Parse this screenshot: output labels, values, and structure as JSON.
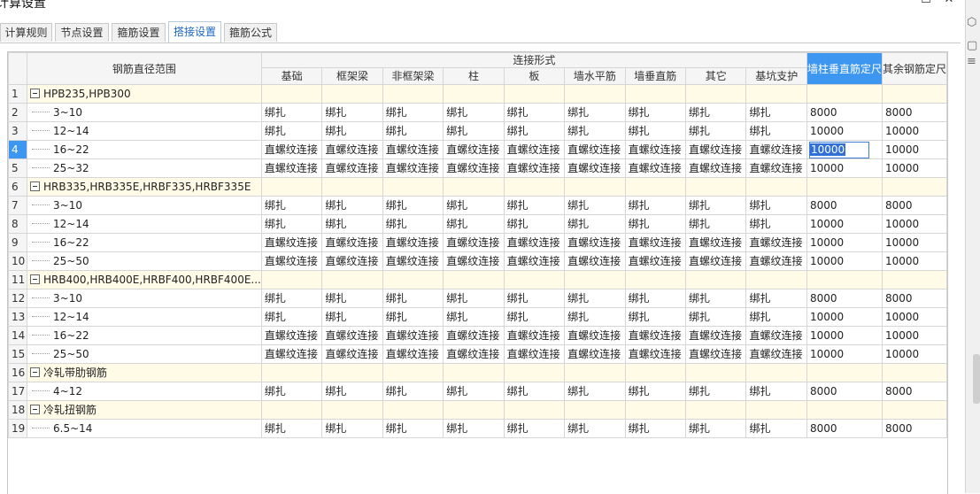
{
  "window": {
    "title": "计算设置",
    "minimize": "—",
    "maximize": "☐",
    "close": "✕"
  },
  "tabs": [
    {
      "label": "计算规则",
      "active": false
    },
    {
      "label": "节点设置",
      "active": false
    },
    {
      "label": "箍筋设置",
      "active": false
    },
    {
      "label": "搭接设置",
      "active": true
    },
    {
      "label": "箍筋公式",
      "active": false
    }
  ],
  "header": {
    "range_col": "钢筋直径范围",
    "group_col": "连接形式",
    "columns": [
      "基础",
      "框架梁",
      "非框架梁",
      "柱",
      "板",
      "墙水平筋",
      "墙垂直筋",
      "其它",
      "基坑支护"
    ],
    "col_wall_col_length": "墙柱垂直筋定尺",
    "col_other_length": "其余钢筋定尺"
  },
  "rows": [
    {
      "num": "1",
      "type": "group",
      "label": "HPB235,HPB300"
    },
    {
      "num": "2",
      "type": "item",
      "label": "3~10",
      "values": [
        "绑扎",
        "绑扎",
        "绑扎",
        "绑扎",
        "绑扎",
        "绑扎",
        "绑扎",
        "绑扎",
        "绑扎"
      ],
      "len1": "8000",
      "len2": "8000"
    },
    {
      "num": "3",
      "type": "item",
      "label": "12~14",
      "values": [
        "绑扎",
        "绑扎",
        "绑扎",
        "绑扎",
        "绑扎",
        "绑扎",
        "绑扎",
        "绑扎",
        "绑扎"
      ],
      "len1": "10000",
      "len2": "10000"
    },
    {
      "num": "4",
      "type": "item",
      "label": "16~22",
      "values": [
        "直螺纹连接",
        "直螺纹连接",
        "直螺纹连接",
        "直螺纹连接",
        "直螺纹连接",
        "直螺纹连接",
        "直螺纹连接",
        "直螺纹连接",
        "直螺纹连接"
      ],
      "len1": "10000",
      "len2": "10000",
      "selected": true
    },
    {
      "num": "5",
      "type": "item",
      "label": "25~32",
      "values": [
        "直螺纹连接",
        "直螺纹连接",
        "直螺纹连接",
        "直螺纹连接",
        "直螺纹连接",
        "直螺纹连接",
        "直螺纹连接",
        "直螺纹连接",
        "直螺纹连接"
      ],
      "len1": "10000",
      "len2": "10000"
    },
    {
      "num": "6",
      "type": "group",
      "label": "HRB335,HRB335E,HRBF335,HRBF335E"
    },
    {
      "num": "7",
      "type": "item",
      "label": "3~10",
      "values": [
        "绑扎",
        "绑扎",
        "绑扎",
        "绑扎",
        "绑扎",
        "绑扎",
        "绑扎",
        "绑扎",
        "绑扎"
      ],
      "len1": "8000",
      "len2": "8000"
    },
    {
      "num": "8",
      "type": "item",
      "label": "12~14",
      "values": [
        "绑扎",
        "绑扎",
        "绑扎",
        "绑扎",
        "绑扎",
        "绑扎",
        "绑扎",
        "绑扎",
        "绑扎"
      ],
      "len1": "10000",
      "len2": "10000"
    },
    {
      "num": "9",
      "type": "item",
      "label": "16~22",
      "values": [
        "直螺纹连接",
        "直螺纹连接",
        "直螺纹连接",
        "直螺纹连接",
        "直螺纹连接",
        "直螺纹连接",
        "直螺纹连接",
        "直螺纹连接",
        "直螺纹连接"
      ],
      "len1": "10000",
      "len2": "10000"
    },
    {
      "num": "10",
      "type": "item",
      "label": "25~50",
      "values": [
        "直螺纹连接",
        "直螺纹连接",
        "直螺纹连接",
        "直螺纹连接",
        "直螺纹连接",
        "直螺纹连接",
        "直螺纹连接",
        "直螺纹连接",
        "直螺纹连接"
      ],
      "len1": "10000",
      "len2": "10000"
    },
    {
      "num": "11",
      "type": "group",
      "label": "HRB400,HRB400E,HRBF400,HRBF400E..."
    },
    {
      "num": "12",
      "type": "item",
      "label": "3~10",
      "values": [
        "绑扎",
        "绑扎",
        "绑扎",
        "绑扎",
        "绑扎",
        "绑扎",
        "绑扎",
        "绑扎",
        "绑扎"
      ],
      "len1": "8000",
      "len2": "8000"
    },
    {
      "num": "13",
      "type": "item",
      "label": "12~14",
      "values": [
        "绑扎",
        "绑扎",
        "绑扎",
        "绑扎",
        "绑扎",
        "绑扎",
        "绑扎",
        "绑扎",
        "绑扎"
      ],
      "len1": "10000",
      "len2": "10000"
    },
    {
      "num": "14",
      "type": "item",
      "label": "16~22",
      "values": [
        "直螺纹连接",
        "直螺纹连接",
        "直螺纹连接",
        "直螺纹连接",
        "直螺纹连接",
        "直螺纹连接",
        "直螺纹连接",
        "直螺纹连接",
        "直螺纹连接"
      ],
      "len1": "10000",
      "len2": "10000"
    },
    {
      "num": "15",
      "type": "item",
      "label": "25~50",
      "values": [
        "直螺纹连接",
        "直螺纹连接",
        "直螺纹连接",
        "直螺纹连接",
        "直螺纹连接",
        "直螺纹连接",
        "直螺纹连接",
        "直螺纹连接",
        "直螺纹连接"
      ],
      "len1": "10000",
      "len2": "10000"
    },
    {
      "num": "16",
      "type": "group",
      "label": "冷轧带肋钢筋"
    },
    {
      "num": "17",
      "type": "item",
      "label": "4~12",
      "values": [
        "绑扎",
        "绑扎",
        "绑扎",
        "绑扎",
        "绑扎",
        "绑扎",
        "绑扎",
        "绑扎",
        "绑扎"
      ],
      "len1": "8000",
      "len2": "8000"
    },
    {
      "num": "18",
      "type": "group",
      "label": "冷轧扭钢筋"
    },
    {
      "num": "19",
      "type": "item",
      "label": "6.5~14",
      "values": [
        "绑扎",
        "绑扎",
        "绑扎",
        "绑扎",
        "绑扎",
        "绑扎",
        "绑扎",
        "绑扎",
        "绑扎"
      ],
      "len1": "8000",
      "len2": "8000"
    }
  ],
  "colors": {
    "accent": "#3d96f0",
    "group_row": "#fffbe7",
    "selection": "#3170d6"
  },
  "side_icons": [
    "cube-icon",
    "square-icon",
    "list-icon"
  ]
}
